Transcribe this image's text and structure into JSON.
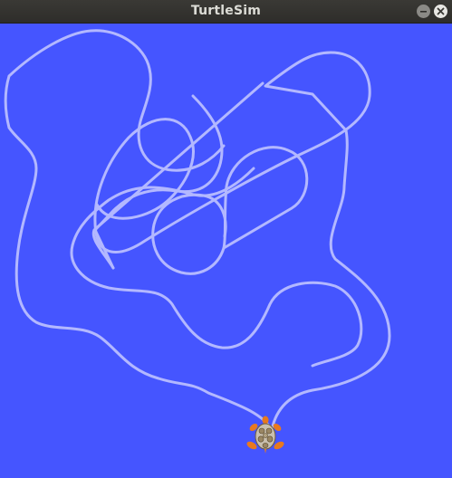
{
  "window": {
    "title": "TurtleSim",
    "controls": [
      {
        "name": "minimize-button",
        "icon": "minimize-icon"
      },
      {
        "name": "close-button",
        "icon": "close-icon"
      }
    ]
  },
  "canvas": {
    "background_color": "#4555ff",
    "trail_color": "#b3b8ff",
    "turtle": {
      "icon": "turtle-icon",
      "shell_color": "#c9bfae",
      "limb_color": "#e8791e"
    }
  }
}
